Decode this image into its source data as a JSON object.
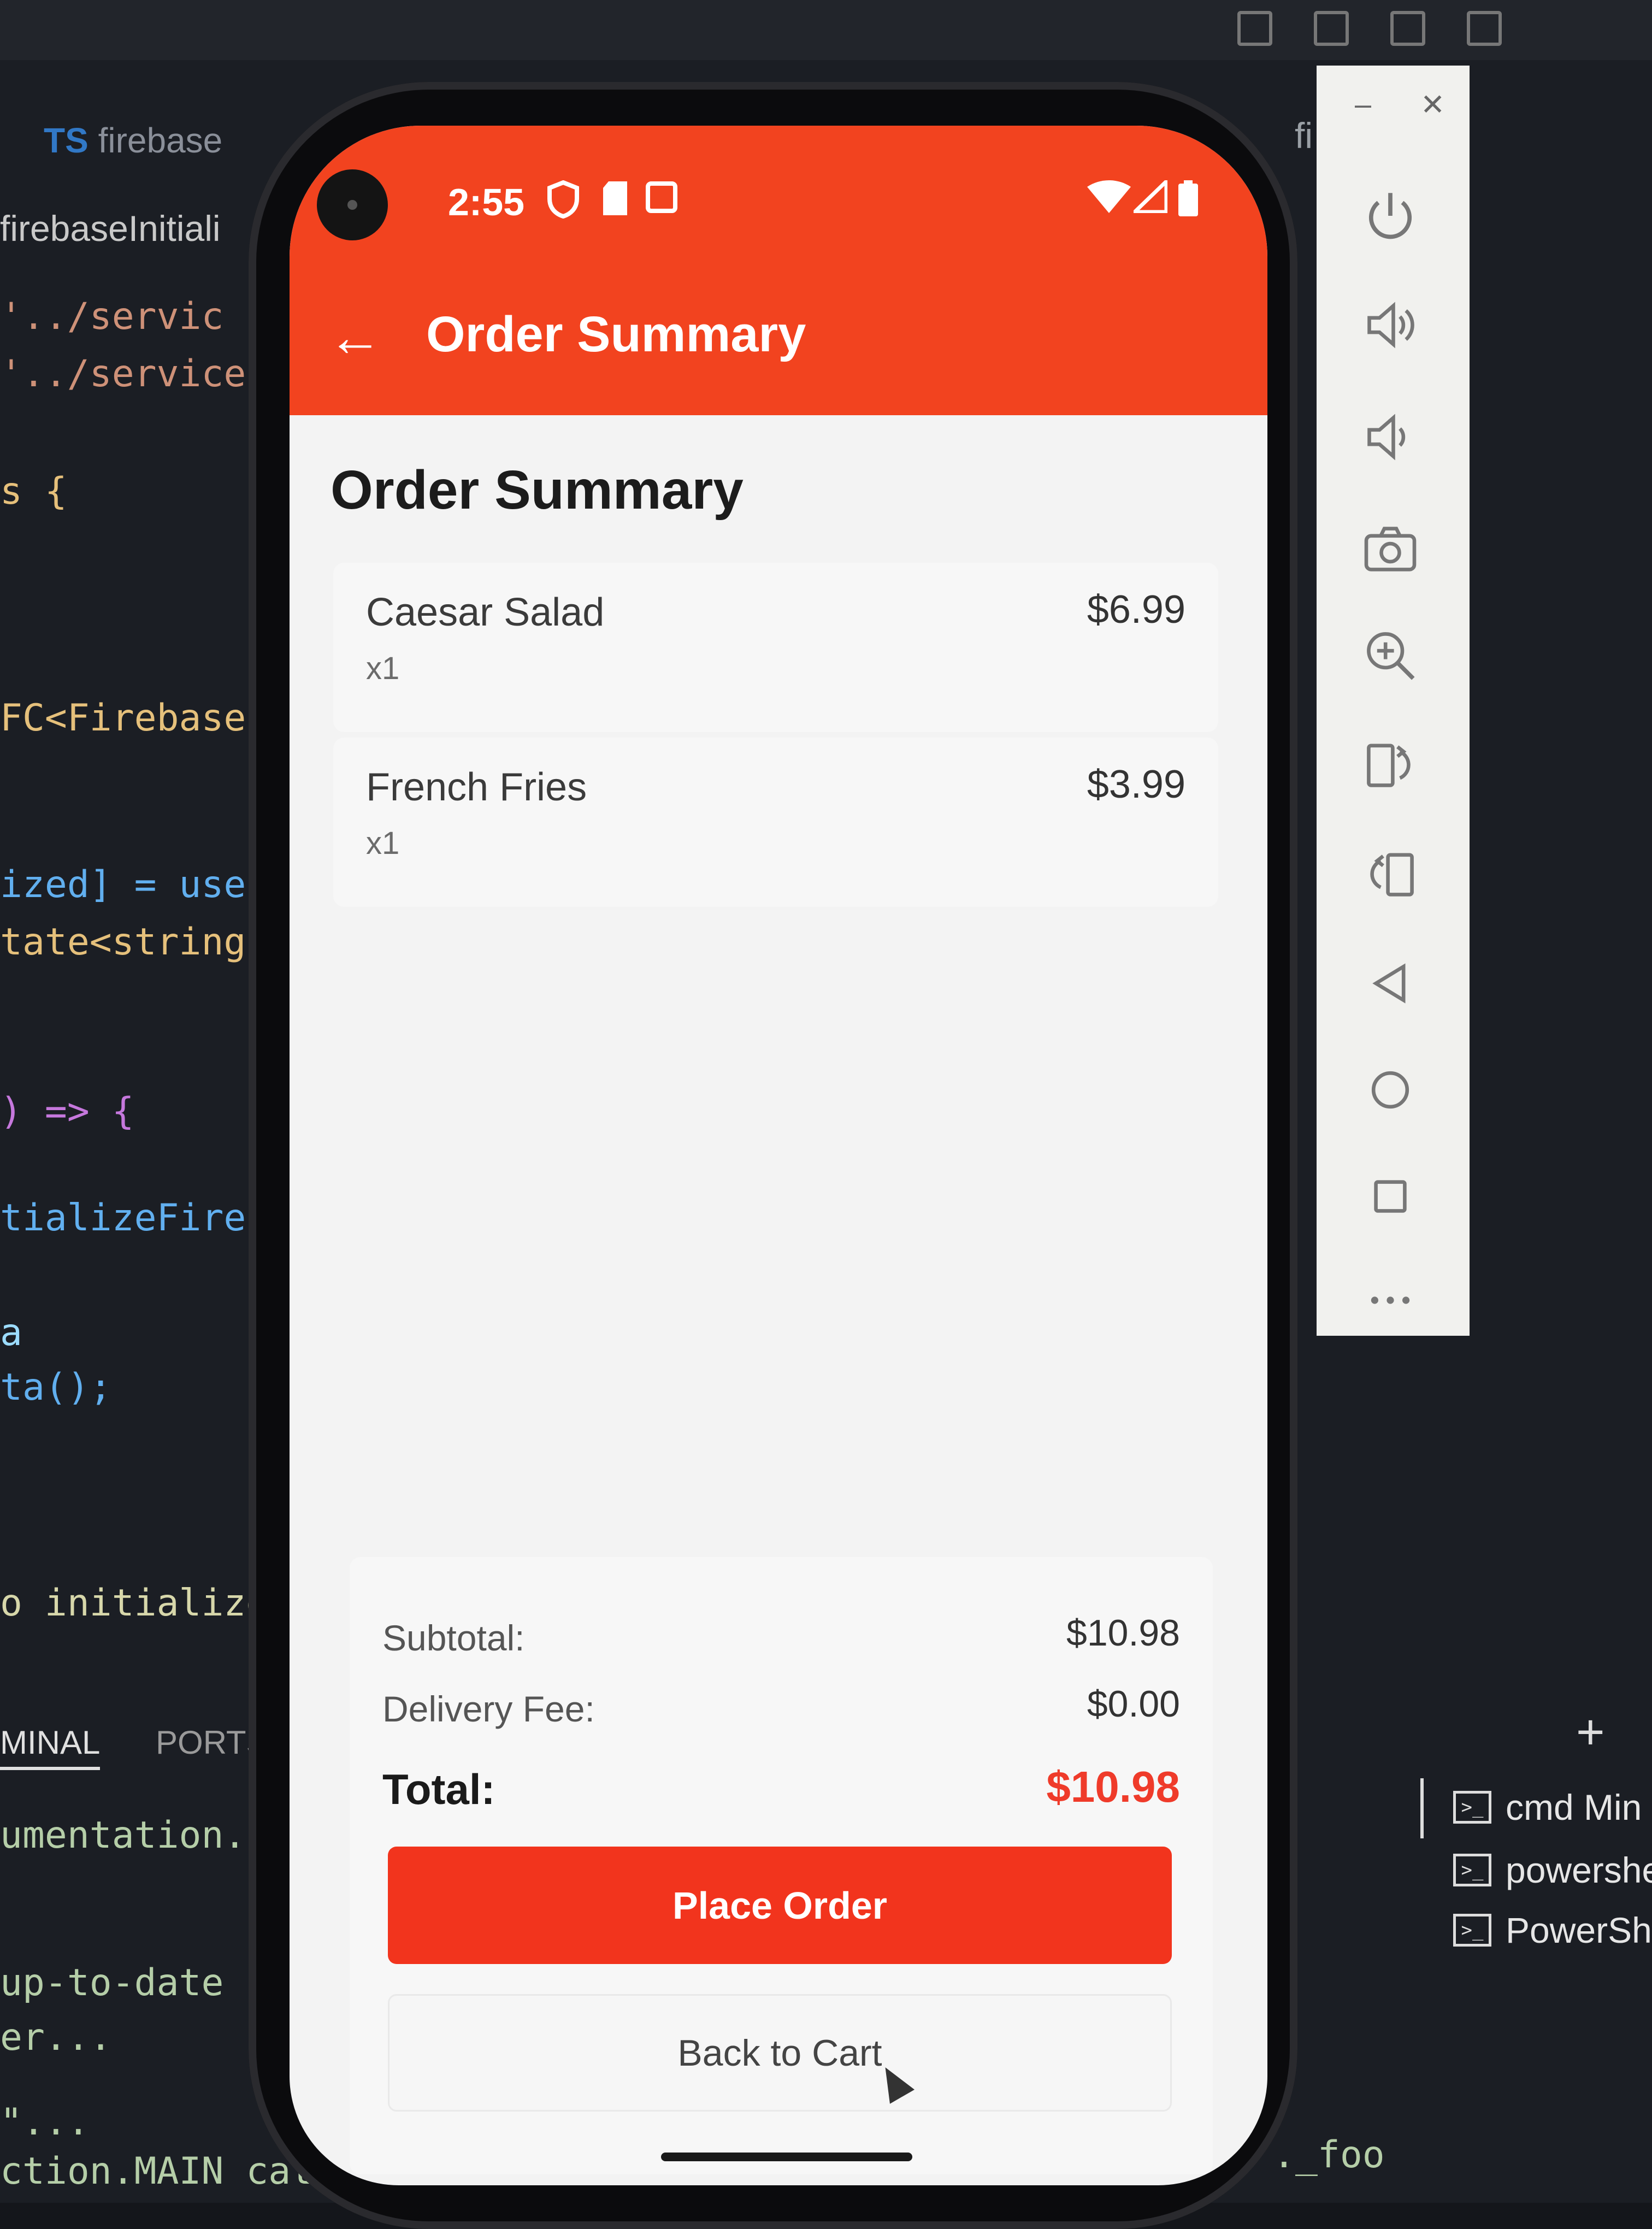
{
  "vscode": {
    "tab_label": "firebase",
    "file_label": "firebaseInitiali",
    "code_lines": [
      "'../servic",
      "'../service",
      "s {",
      "FC<Firebase",
      "ized] = useS",
      "tate<string",
      ") => {",
      "tializeFires",
      "a",
      "ta();",
      "o initialize"
    ],
    "panel_tabs": [
      "MINAL",
      "PORTS"
    ],
    "terminal_lines": [
      "umentation.",
      "up-to-date",
      "er...",
      "\"...",
      "ction.MAIN cat"
    ],
    "right_fragment": "fi",
    "bottom_right_text": "._foo",
    "terminals": [
      "cmd Min",
      "powershe",
      "PowerShe"
    ]
  },
  "status_bar": {
    "time": "2:55"
  },
  "app_bar": {
    "title": "Order Summary"
  },
  "page": {
    "heading": "Order Summary"
  },
  "items": [
    {
      "name": "Caesar Salad",
      "qty": "x1",
      "price": "$6.99"
    },
    {
      "name": "French Fries",
      "qty": "x1",
      "price": "$3.99"
    }
  ],
  "summary": {
    "subtotal_label": "Subtotal:",
    "subtotal_value": "$10.98",
    "delivery_label": "Delivery Fee:",
    "delivery_value": "$0.00",
    "total_label": "Total:",
    "total_value": "$10.98"
  },
  "buttons": {
    "place_order": "Place Order",
    "back_to_cart": "Back to Cart"
  },
  "emulator_panel": {
    "icons": [
      "power-icon",
      "volume-up-icon",
      "volume-down-icon",
      "camera-icon",
      "zoom-in-icon",
      "rotate-right-icon",
      "rotate-left-icon",
      "back-icon",
      "home-icon",
      "overview-icon",
      "more-icon"
    ]
  },
  "colors": {
    "accent": "#f2431f",
    "total": "#ef3b2a"
  }
}
